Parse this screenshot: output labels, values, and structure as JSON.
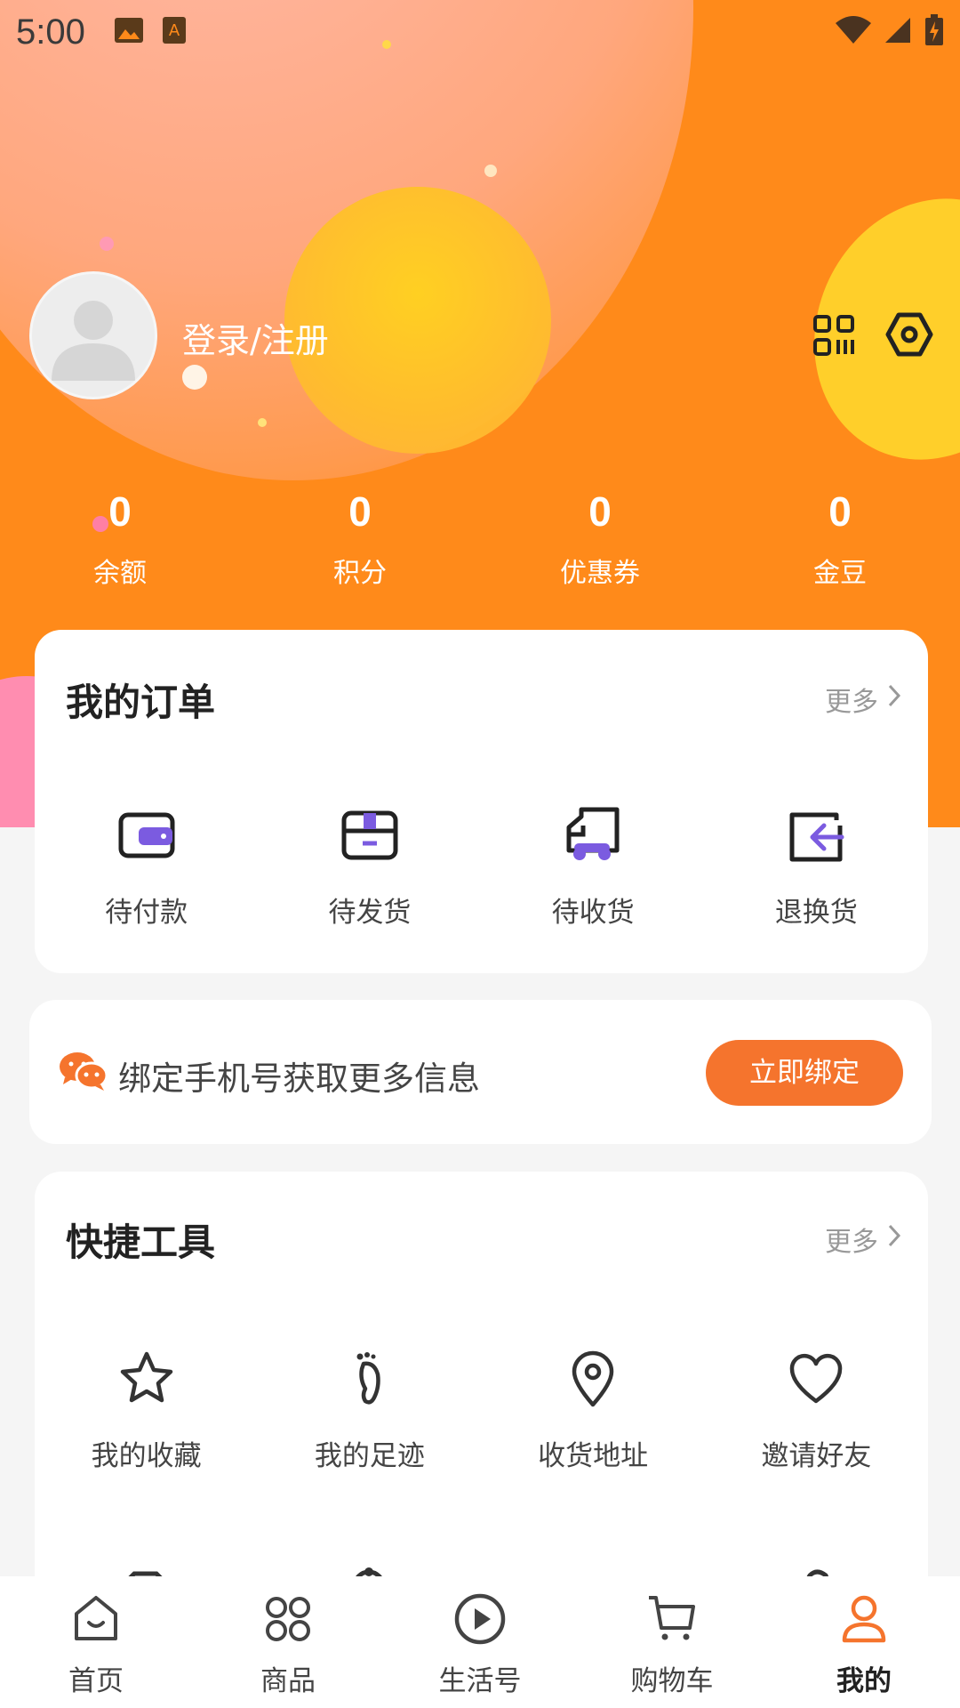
{
  "status_bar": {
    "time": "5:00"
  },
  "profile": {
    "login_label": "登录/注册"
  },
  "stats": [
    {
      "value": "0",
      "label": "余额"
    },
    {
      "value": "0",
      "label": "积分"
    },
    {
      "value": "0",
      "label": "优惠券"
    },
    {
      "value": "0",
      "label": "金豆"
    }
  ],
  "orders": {
    "title": "我的订单",
    "more": "更多",
    "items": [
      {
        "label": "待付款",
        "icon": "wallet-icon"
      },
      {
        "label": "待发货",
        "icon": "box-icon"
      },
      {
        "label": "待收货",
        "icon": "truck-icon"
      },
      {
        "label": "退换货",
        "icon": "return-icon"
      }
    ]
  },
  "bind_phone": {
    "text": "绑定手机号获取更多信息",
    "button": "立即绑定",
    "icon": "wechat-icon"
  },
  "tools": {
    "title": "快捷工具",
    "more": "更多",
    "items": [
      {
        "label": "我的收藏",
        "icon": "star-icon"
      },
      {
        "label": "我的足迹",
        "icon": "footprint-icon"
      },
      {
        "label": "收货地址",
        "icon": "location-icon"
      },
      {
        "label": "邀请好友",
        "icon": "heart-icon"
      }
    ]
  },
  "tabbar": {
    "items": [
      {
        "label": "首页",
        "icon": "home-icon"
      },
      {
        "label": "商品",
        "icon": "grid-icon"
      },
      {
        "label": "生活号",
        "icon": "play-icon"
      },
      {
        "label": "购物车",
        "icon": "cart-icon"
      },
      {
        "label": "我的",
        "icon": "user-icon",
        "active": true
      }
    ]
  },
  "colors": {
    "brand_orange": "#ff8a1a",
    "button_orange": "#f5742d",
    "accent_purple": "#7b5be0"
  }
}
